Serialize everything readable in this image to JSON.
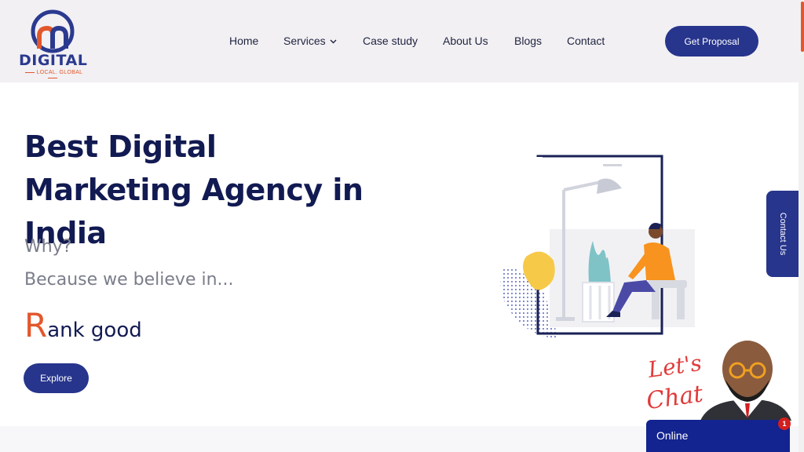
{
  "logo": {
    "word": "DIGITAL",
    "tagline": "LOCAL. GLOBAL"
  },
  "nav": {
    "items": [
      {
        "label": "Home"
      },
      {
        "label": "Services"
      },
      {
        "label": "Case study"
      },
      {
        "label": "About Us"
      },
      {
        "label": "Blogs"
      },
      {
        "label": "Contact"
      }
    ],
    "cta": "Get Proposal"
  },
  "hero": {
    "title": "Best Digital Marketing Agency in India",
    "why": "Why?",
    "because": "Because we believe in...",
    "rank_first": "R",
    "rank_rest": "ank good",
    "explore": "Explore"
  },
  "contact_tab": "Contact Us",
  "chat": {
    "art_line1": "Let's",
    "art_line2": "Chat",
    "status": "Online",
    "badge": "1"
  },
  "colors": {
    "brand": "#27358c",
    "accent": "#e2572b",
    "heading": "#121a52",
    "header_bg": "#f2f0f3"
  }
}
